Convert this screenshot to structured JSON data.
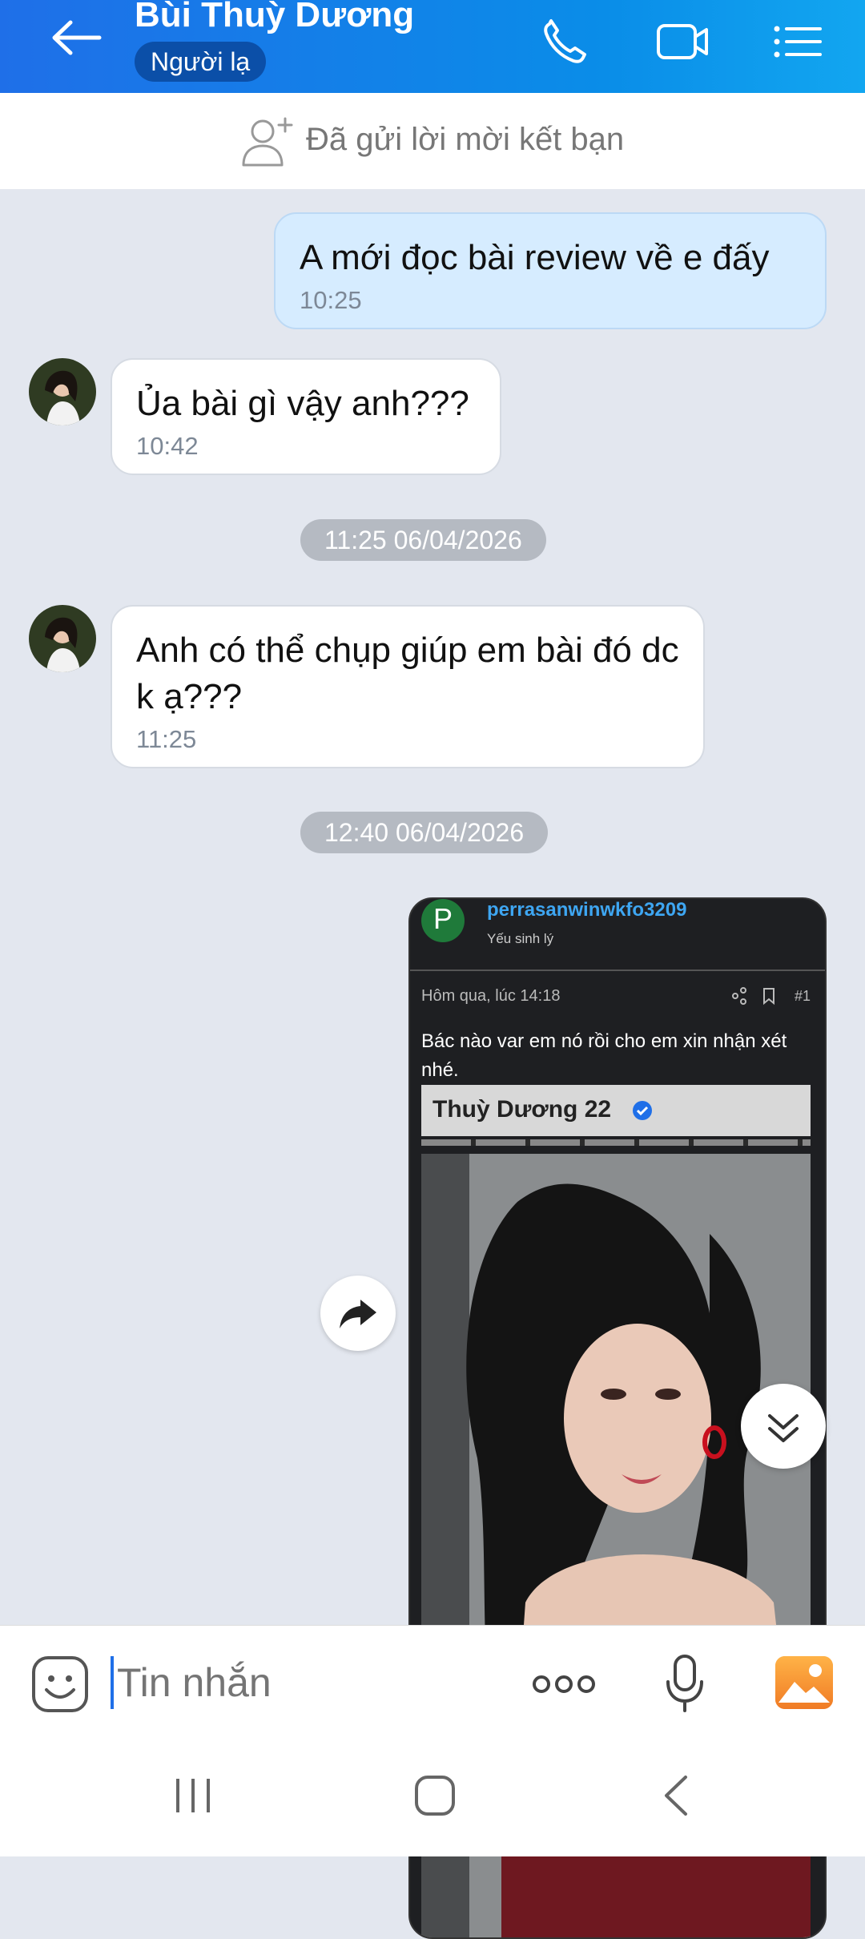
{
  "header": {
    "title": "Bùi Thuỳ Dương",
    "badge": "Người lạ",
    "back_icon": "arrow-left-icon",
    "actions": [
      "phone-icon",
      "video-call-icon",
      "menu-list-icon"
    ]
  },
  "friend_request": {
    "icon": "add-friend-icon",
    "text": "Đã gửi lời mời kết bạn"
  },
  "messages": [
    {
      "direction": "out",
      "text": "A mới đọc bài review về e đấy",
      "time": "10:25"
    },
    {
      "direction": "in",
      "text": "Ủa bài gì vậy anh???",
      "time": "10:42"
    },
    {
      "direction": "in",
      "text": "Anh có thể chụp giúp em bài đó dc k ạ???",
      "time": "11:25"
    }
  ],
  "separators": [
    "11:25 06/04/2026",
    "12:40 06/04/2026"
  ],
  "image_message": {
    "avatar_letter": "P",
    "username": "perrasanwinwkfo3209",
    "user_title": "Yếu sinh lý",
    "post_time": "Hôm qua, lúc 14:18",
    "post_number": "#1",
    "post_text": "Bác nào var em nó rồi cho em xin nhận xét nhé.",
    "profile_name": "Thuỳ Dương 22"
  },
  "composer": {
    "placeholder": "Tin nhắn",
    "icons": [
      "sticker-icon",
      "more-icon",
      "microphone-icon",
      "gallery-icon"
    ]
  },
  "colors": {
    "header": "#1f6fe8",
    "outgoing_bubble": "#d6ecff",
    "background": "#e3e7ef"
  }
}
